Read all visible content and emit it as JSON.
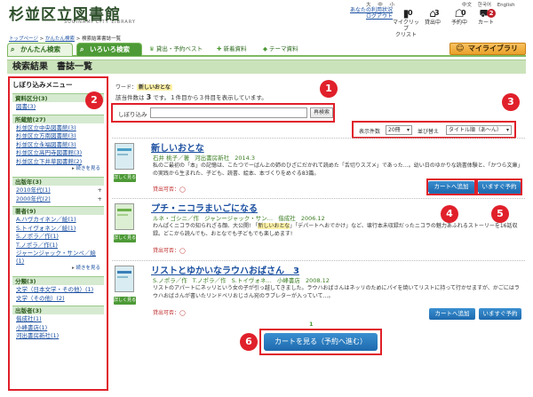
{
  "header": {
    "logo": "杉並区立図書館",
    "logo_sub": "SUGINAMI CITY LIBRARY",
    "font_sizes": [
      "大",
      "中",
      "小"
    ],
    "languages": [
      "中文",
      "한국어",
      "English"
    ],
    "status_label": "あなたの利用状況",
    "logout": "ログアウト",
    "nav": [
      {
        "label": "マイクリップ",
        "label2": "クリップ",
        "count": "0",
        "icon": "clip-icon"
      },
      {
        "label": "貸出中",
        "count": "3",
        "icon": "book-icon"
      },
      {
        "label": "予約中",
        "count": "0",
        "icon": "reserve-icon"
      },
      {
        "label": "カート",
        "count": "2",
        "icon": "cart-icon"
      }
    ],
    "nav_line1": "マイクリップ",
    "nav_line2": "クリスト"
  },
  "breadcrumb": {
    "home": "トップページ",
    "sep": " > ",
    "simple": "かんたん検索",
    "current": "検索結果書誌一覧"
  },
  "tabs": {
    "simple": "かんたん検索",
    "advanced": "いろいろ検索",
    "links": [
      "貸出・予約ベスト",
      "新着資料",
      "テーマ資料"
    ],
    "mylibrary": "マイライブラリ"
  },
  "page_title": "検索結果　書誌一覧",
  "sidebar": {
    "title": "しぼり込みメニュー",
    "more_label": "続きを見る",
    "sections": [
      {
        "head": "資料区分(3)",
        "items": [
          {
            "label": "図書(3)",
            "plus": ""
          }
        ],
        "more": false
      },
      {
        "head": "所蔵館(27)",
        "items": [
          {
            "label": "杉並区立中央図書館(3)",
            "plus": ""
          },
          {
            "label": "杉並区立方南図書館(3)",
            "plus": ""
          },
          {
            "label": "杉並区立永福図書館(3)",
            "plus": ""
          },
          {
            "label": "杉並区立高円寺図書館(3)",
            "plus": ""
          },
          {
            "label": "杉並区立下井草図書館(2)",
            "plus": ""
          }
        ],
        "more": true
      },
      {
        "head": "出版年(3)",
        "items": [
          {
            "label": "2010年代(1)",
            "plus": "+"
          },
          {
            "label": "2000年代(2)",
            "plus": "+"
          }
        ],
        "more": false
      },
      {
        "head": "著者(9)",
        "items": [
          {
            "label": "A.ハヴカイネン／絵(1)",
            "plus": ""
          },
          {
            "label": "S.トイヴォネン／絵(1)",
            "plus": ""
          },
          {
            "label": "S.ノポラ／作(1)",
            "plus": ""
          },
          {
            "label": "T.ノポラ／作(1)",
            "plus": ""
          },
          {
            "label": "ジャーンジャック・サンペ／絵(1)",
            "plus": ""
          }
        ],
        "more": true
      },
      {
        "head": "分類(3)",
        "items": [
          {
            "label": "文学（日本文学・その他）(1)",
            "plus": ""
          },
          {
            "label": "文学（その他）(2)",
            "plus": ""
          }
        ],
        "more": false
      },
      {
        "head": "出版者(3)",
        "items": [
          {
            "label": "偕成社(1)",
            "plus": ""
          },
          {
            "label": "小峰書店(1)",
            "plus": ""
          },
          {
            "label": "河出書房新社(1)",
            "plus": ""
          }
        ],
        "more": false
      }
    ]
  },
  "search": {
    "word_label": "ワード：",
    "word_value": "新しいおとな",
    "count_prefix": "該当件数は",
    "count": "3",
    "count_suffix": "です。１件目から３件目を表示しています。",
    "filter_label": "しぼり込み",
    "filter_value": "",
    "filter_button": "再検索"
  },
  "sort": {
    "per_page_label": "表示件数",
    "per_page_value": "20冊",
    "order_label": "並び替え",
    "order_value": "タイトル順（あ〜ん）"
  },
  "results": [
    {
      "title": "新しいおとな",
      "author": "石井 桃子／著",
      "publisher": "河出書房新社",
      "year": "2014.3",
      "desc_a": "私のご最初の「本」の記憶は、こたつでーばん上の姉のひざにだかれて読めた「舌切りスズメ」であった…。幼い日のゆかりな読書体験と、「かつら文庫」の実践から生まれた、子ども、読書、絵本、本づくりをめぐる83篇。",
      "desc_b": "",
      "availability": "貸出可否：",
      "avail_mark": "◯",
      "detail": "詳しく見る"
    },
    {
      "title": "プチ・ニコラまいごになる",
      "author": "ルネ・ゴシニ／作",
      "author2": "ジャンージャック・サン…",
      "publisher": "偕成社",
      "year": "2006.12",
      "desc_a": "わんぱくニコラの知られざる顔、大公開! 「",
      "desc_hl": "新しいおとな",
      "desc_b": "」「デパートへおでかけ」など、壊行本未収録だったニコラの魅力あふれるストーリーを16話収録。どこから読んでも、おとなでも子どもでも楽しめます!",
      "availability": "貸出可否：",
      "avail_mark": "◯",
      "detail": "詳しく見る"
    },
    {
      "title": "リストとゆかいなラウハおばさん　3",
      "author": "S.ノポラ／作",
      "author2": "T.ノポラ／作",
      "author3": "S.トイヴォネ…",
      "publisher": "小峰書店",
      "year": "2008.12",
      "desc_a": "リストのアパートにネッリという女の子が引っ越してきました。ラウハおばさんはネッリのためにパイを焼いてリストに持って行かせますが、かごにはラウハおばさんが書いたリンドベリおじさん宛のラブレターが入っていて…。",
      "desc_b": "",
      "availability": "貸出可否：",
      "avail_mark": "◯",
      "detail": "詳しく見る"
    }
  ],
  "actions": {
    "add_cart": "カートへ追加",
    "reserve_now": "いますぐ予約"
  },
  "pager": {
    "current": "1"
  },
  "cart_cta": "カートを見る（予約へ進む）",
  "badges": [
    "1",
    "2",
    "3",
    "4",
    "5",
    "6"
  ],
  "colors": {
    "accent_green": "#4d9a36",
    "annotation_red": "#e0202a",
    "button_blue": "#1e6aae"
  }
}
